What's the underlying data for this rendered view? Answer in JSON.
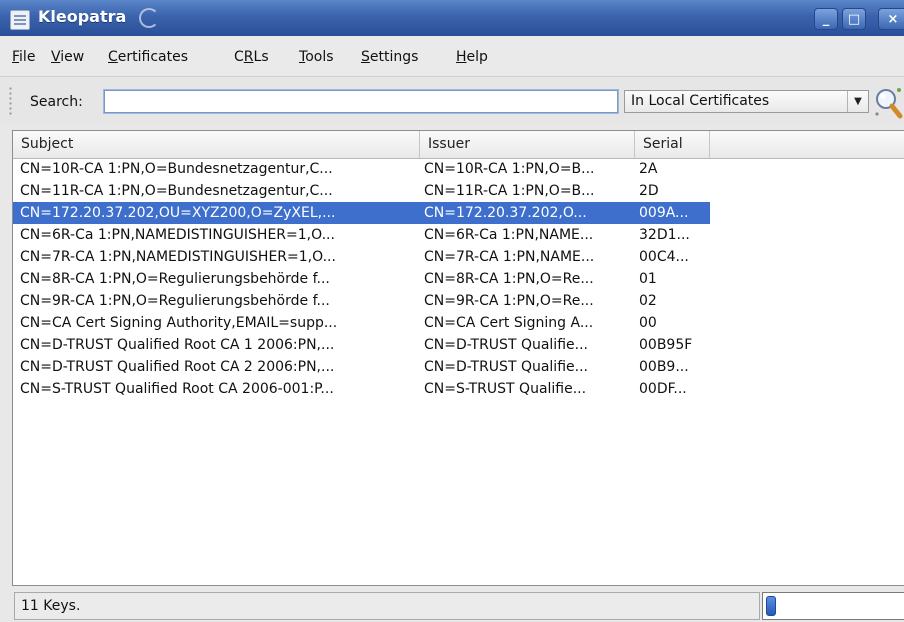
{
  "window": {
    "title": "Kleopatra",
    "controls": [
      "minimize",
      "maximize",
      "close"
    ]
  },
  "menu": [
    {
      "pre": "",
      "mn": "F",
      "post": "ile"
    },
    {
      "pre": "",
      "mn": "V",
      "post": "iew"
    },
    {
      "pre": "",
      "mn": "C",
      "post": "ertificates"
    },
    {
      "pre": "C",
      "mn": "R",
      "post": "Ls"
    },
    {
      "pre": "",
      "mn": "T",
      "post": "ools"
    },
    {
      "pre": "",
      "mn": "S",
      "post": "ettings"
    },
    {
      "pre": "",
      "mn": "H",
      "post": "elp"
    }
  ],
  "search": {
    "label": "Search:",
    "value": "",
    "scope": "In Local Certificates"
  },
  "table": {
    "columns": [
      "Subject",
      "Issuer",
      "Serial"
    ],
    "selected_index": 2,
    "rows": [
      {
        "subject": "CN=10R-CA 1:PN,O=Bundesnetzagentur,C...",
        "issuer": "CN=10R-CA 1:PN,O=B...",
        "serial": "2A"
      },
      {
        "subject": "CN=11R-CA 1:PN,O=Bundesnetzagentur,C...",
        "issuer": "CN=11R-CA 1:PN,O=B...",
        "serial": "2D"
      },
      {
        "subject": "CN=172.20.37.202,OU=XYZ200,O=ZyXEL,...",
        "issuer": "CN=172.20.37.202,O...",
        "serial": "009A..."
      },
      {
        "subject": "CN=6R-Ca 1:PN,NAMEDISTINGUISHER=1,O...",
        "issuer": "CN=6R-Ca 1:PN,NAME...",
        "serial": "32D1..."
      },
      {
        "subject": "CN=7R-CA 1:PN,NAMEDISTINGUISHER=1,O...",
        "issuer": "CN=7R-CA 1:PN,NAME...",
        "serial": "00C4..."
      },
      {
        "subject": "CN=8R-CA 1:PN,O=Regulierungsbehörde f...",
        "issuer": "CN=8R-CA 1:PN,O=Re...",
        "serial": "01"
      },
      {
        "subject": "CN=9R-CA 1:PN,O=Regulierungsbehörde f...",
        "issuer": "CN=9R-CA 1:PN,O=Re...",
        "serial": "02"
      },
      {
        "subject": "CN=CA Cert Signing Authority,EMAIL=supp...",
        "issuer": "CN=CA Cert Signing A...",
        "serial": "00"
      },
      {
        "subject": "CN=D-TRUST Qualified Root CA 1 2006:PN,...",
        "issuer": "CN=D-TRUST Qualifie...",
        "serial": "00B95F"
      },
      {
        "subject": "CN=D-TRUST Qualified Root CA 2 2006:PN,...",
        "issuer": "CN=D-TRUST Qualifie...",
        "serial": "00B9..."
      },
      {
        "subject": "CN=S-TRUST Qualified Root CA 2006-001:P...",
        "issuer": "CN=S-TRUST Qualifie...",
        "serial": "00DF..."
      }
    ]
  },
  "status": {
    "text": "11 Keys.",
    "progress": 0.05
  },
  "icons": {
    "app": "kleopatra-app-icon",
    "search": "magnifier-icon"
  },
  "colors": {
    "titlebar": "#3b63ad",
    "selection": "#3e6fcd"
  }
}
